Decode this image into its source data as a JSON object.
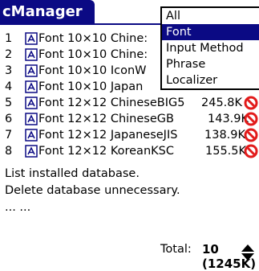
{
  "app": {
    "title": "cManager"
  },
  "category_dropdown": {
    "items": [
      {
        "label": "All",
        "selected": false
      },
      {
        "label": "Font",
        "selected": true
      },
      {
        "label": "Input Method",
        "selected": false
      },
      {
        "label": "Phrase",
        "selected": false
      },
      {
        "label": "Localizer",
        "selected": false
      }
    ]
  },
  "databases": [
    {
      "index": "1",
      "name": "Font 10×10 Chine:",
      "size": ""
    },
    {
      "index": "2",
      "name": "Font 10×10 Chine:",
      "size": ""
    },
    {
      "index": "3",
      "name": "Font 10×10 IconW",
      "size": ""
    },
    {
      "index": "4",
      "name": "Font 10×10 Japan",
      "size": ""
    },
    {
      "index": "5",
      "name": "Font 12×12 ChineseBIG5",
      "size": "245.8K"
    },
    {
      "index": "6",
      "name": "Font 12×12 ChineseGB",
      "size": "143.9K"
    },
    {
      "index": "7",
      "name": "Font 12×12 JapaneseJIS",
      "size": "138.9K"
    },
    {
      "index": "8",
      "name": "Font 12×12 KoreanKSC",
      "size": "155.5K"
    }
  ],
  "info": {
    "line1": "List installed database.",
    "line2": "Delete database unnecessary.",
    "line3": "... ..."
  },
  "footer": {
    "total_label": "Total:",
    "total_value": "10 (1245K)"
  },
  "icons": {
    "db": "database-icon",
    "delete": "delete-icon",
    "scroll": "scroll-arrows-icon"
  },
  "colors": {
    "accent": "#0b0a84",
    "delete": "#e21b1b"
  }
}
